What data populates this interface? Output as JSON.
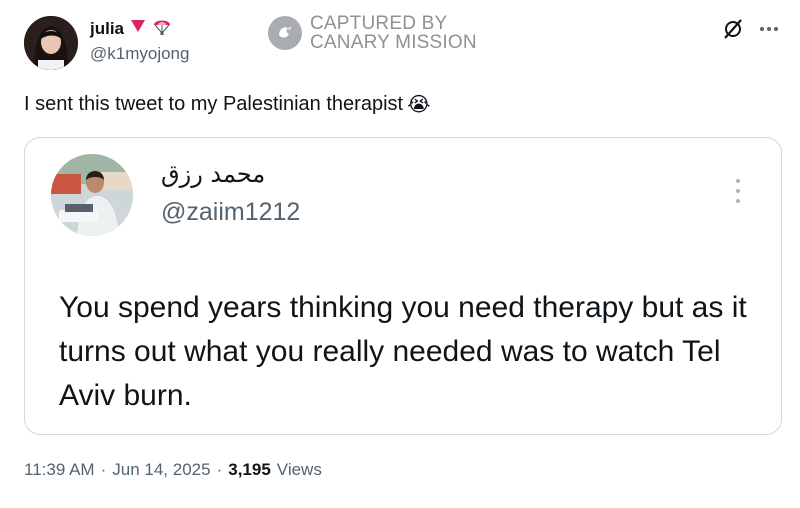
{
  "author": {
    "display_name": "julia",
    "handle": "@k1myojong",
    "badges": [
      "red-heart-icon",
      "parachute-icon"
    ]
  },
  "watermark": {
    "line1": "CAPTURED BY",
    "line2": "CANARY MISSION"
  },
  "tweet": {
    "text": "I sent this tweet to my Palestinian therapist",
    "emoji": "😭"
  },
  "quoted": {
    "display_name": "محمد رزق",
    "handle": "@zaiim1212",
    "body": "You spend years thinking you need therapy but as it turns out what you really needed was to watch Tel Aviv burn."
  },
  "meta": {
    "time": "11:39 AM",
    "date": "Jun 14, 2025",
    "views_count": "3,195",
    "views_label": "Views"
  },
  "colors": {
    "primary_text": "#0f1419",
    "secondary_text": "#536471",
    "border": "#cfd9de",
    "watermark": "#8e9296",
    "badge_red": "#e0245e"
  }
}
